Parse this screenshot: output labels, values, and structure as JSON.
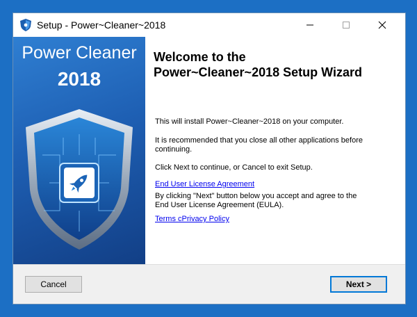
{
  "window": {
    "title": "Setup - Power~Cleaner~2018",
    "controls": [
      "minimize-icon",
      "maximize-icon",
      "close-icon"
    ]
  },
  "sidebar": {
    "product_name": "Power Cleaner",
    "year": "2018",
    "emblem": "rocket-shield-icon"
  },
  "content": {
    "heading_line1": "Welcome to the",
    "heading_line2": "Power~Cleaner~2018 Setup Wizard",
    "install_text": "This will install Power~Cleaner~2018 on your computer.",
    "recommend_line1": "It is recommended that you close all other applications before",
    "recommend_line2": "continuing.",
    "continue_text": "Click Next to continue, or Cancel to exit Setup.",
    "eula_link": "End User License Agreement",
    "agree_line1": "By clicking \"Next\" button below you accept and agree to the",
    "agree_line2": "End User License Agreement (EULA).",
    "terms_link": "Terms cPrivacy Policy"
  },
  "footer": {
    "cancel_label": "Cancel",
    "next_label": "Next >"
  },
  "colors": {
    "desktop": "#1c6fc4",
    "sidebar_top": "#2f7fd2",
    "sidebar_bottom": "#123f86",
    "link": "#0000ee",
    "primary_border": "#0078d7"
  }
}
